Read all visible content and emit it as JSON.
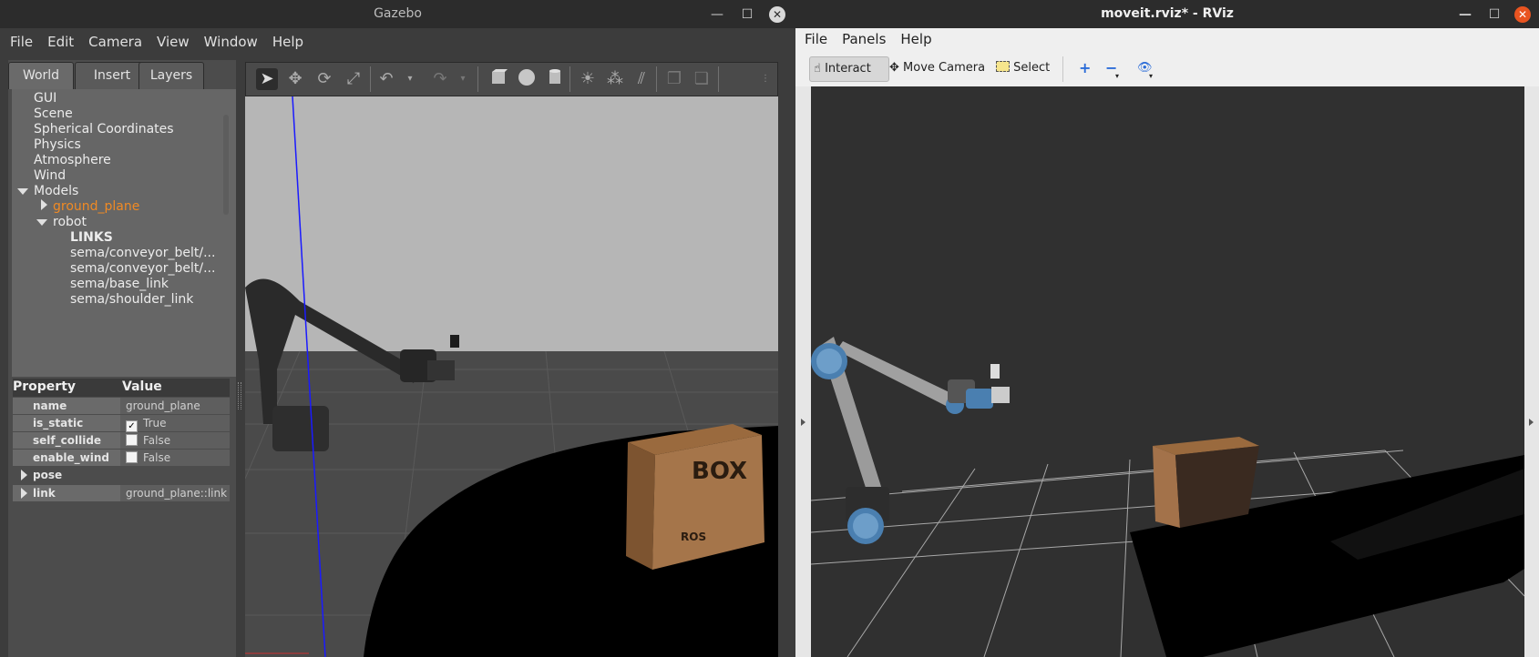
{
  "gazebo": {
    "title": "Gazebo",
    "menu": [
      "File",
      "Edit",
      "Camera",
      "View",
      "Window",
      "Help"
    ],
    "tabs": [
      "World",
      "Insert",
      "Layers"
    ],
    "tree": {
      "items": [
        "GUI",
        "Scene",
        "Spherical Coordinates",
        "Physics",
        "Atmosphere",
        "Wind"
      ],
      "models_label": "Models",
      "ground_plane": "ground_plane",
      "robot": "robot",
      "links_header": "LINKS",
      "links": [
        "sema/conveyor_belt/...",
        "sema/conveyor_belt/...",
        "sema/base_link",
        "sema/shoulder_link"
      ]
    },
    "props": {
      "header_property": "Property",
      "header_value": "Value",
      "rows": [
        {
          "key": "name",
          "value": "ground_plane"
        },
        {
          "key": "is_static",
          "value": "True",
          "checked": true
        },
        {
          "key": "self_collide",
          "value": "False",
          "checked": false
        },
        {
          "key": "enable_wind",
          "value": "False",
          "checked": false
        },
        {
          "key": "pose",
          "value": ""
        },
        {
          "key": "link",
          "value": "ground_plane::link"
        }
      ]
    },
    "scene": {
      "box_label": "BOX",
      "box_sublabel": "ROS"
    }
  },
  "rviz": {
    "title": "moveit.rviz* - RViz",
    "menu": [
      "File",
      "Panels",
      "Help"
    ],
    "tools": {
      "interact": "Interact",
      "move_camera": "Move Camera",
      "select": "Select"
    }
  }
}
